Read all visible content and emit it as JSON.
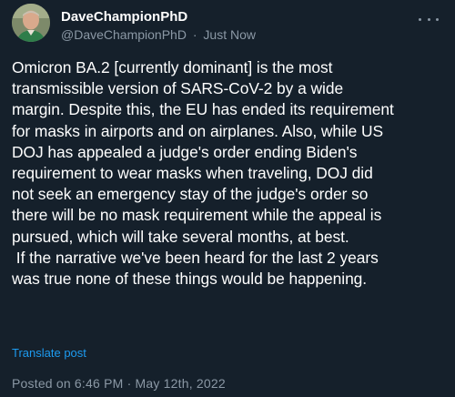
{
  "header": {
    "display_name": "DaveChampionPhD",
    "handle": "@DaveChampionPhD",
    "separator": "·",
    "time": "Just Now"
  },
  "tweet": {
    "text": "Omicron BA.2 [currently dominant] is the most\ntransmissible version of SARS-CoV-2 by a wide\nmargin. Despite this, the EU has ended its requirement\nfor masks in airports and on airplanes. Also, while US\nDOJ has appealed a judge's order ending Biden's\nrequirement to wear masks when traveling, DOJ did\nnot seek an emergency stay of the judge's order so\nthere will be no mask requirement while the appeal is\npursued, which will take several months, at best.\n If the narrative we've been heard for the last 2 years\nwas true none of these things would be happening."
  },
  "actions": {
    "translate_label": "Translate post"
  },
  "footer": {
    "posted_text": "Posted on 6:46 PM · May 12th, 2022"
  },
  "colors": {
    "background": "#15202b",
    "text": "#ffffff",
    "muted": "#8b98a5",
    "link": "#1d9bf0"
  },
  "icons": {
    "avatar": "profile-photo",
    "more": "more-horizontal-icon"
  }
}
